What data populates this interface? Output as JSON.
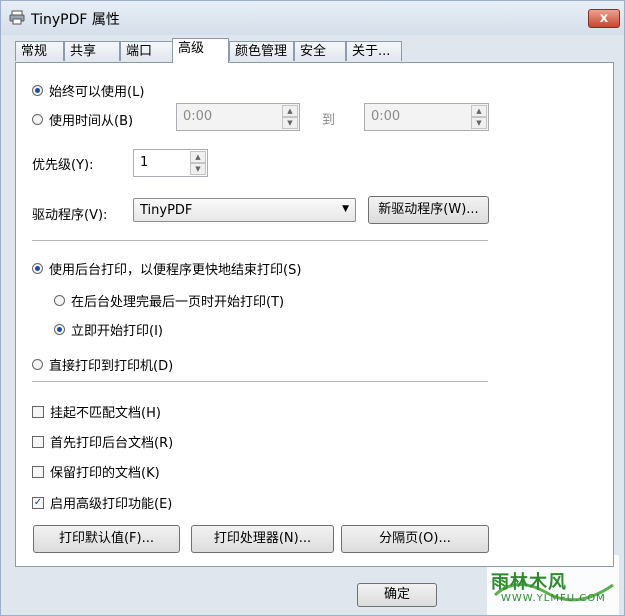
{
  "window": {
    "title": "TinyPDF 属性",
    "close_glyph": "x"
  },
  "tabs": [
    {
      "label": "常规"
    },
    {
      "label": "共享"
    },
    {
      "label": "端口"
    },
    {
      "label": "高级",
      "active": true
    },
    {
      "label": "颜色管理"
    },
    {
      "label": "安全"
    },
    {
      "label": "关于..."
    }
  ],
  "availability": {
    "always_label": "始终可以使用(L)",
    "always_selected": true,
    "time_label": "使用时间从(B)",
    "from_value": "0:00",
    "to_label": "到",
    "to_value": "0:00"
  },
  "priority": {
    "label": "优先级(Y):",
    "value": "1"
  },
  "driver": {
    "label": "驱动程序(V):",
    "value": "TinyPDF",
    "new_button": "新驱动程序(W)..."
  },
  "spool": {
    "spool_label": "使用后台打印，以便程序更快地结束打印(S)",
    "after_last_label": "在后台处理完最后一页时开始打印(T)",
    "immediately_label": "立即开始打印(I)",
    "direct_label": "直接打印到打印机(D)"
  },
  "options": [
    {
      "label": "挂起不匹配文档(H)",
      "checked": false
    },
    {
      "label": "首先打印后台文档(R)",
      "checked": false
    },
    {
      "label": "保留打印的文档(K)",
      "checked": false
    },
    {
      "label": "启用高级打印功能(E)",
      "checked": true
    }
  ],
  "buttons": {
    "defaults": "打印默认值(F)...",
    "processor": "打印处理器(N)...",
    "separator": "分隔页(O)...",
    "ok": "确定"
  },
  "watermark": {
    "text": "雨林木风",
    "url": "WWW.YLMFU.COM"
  },
  "colors": {
    "accent": "#1e4ea1",
    "close": "#c8452e",
    "watermark": "#2e8a2e"
  },
  "icons": {
    "app": "printer-icon",
    "spin_up": "chevron-up-icon",
    "spin_down": "chevron-down-icon",
    "combo": "dropdown-arrow-icon"
  }
}
